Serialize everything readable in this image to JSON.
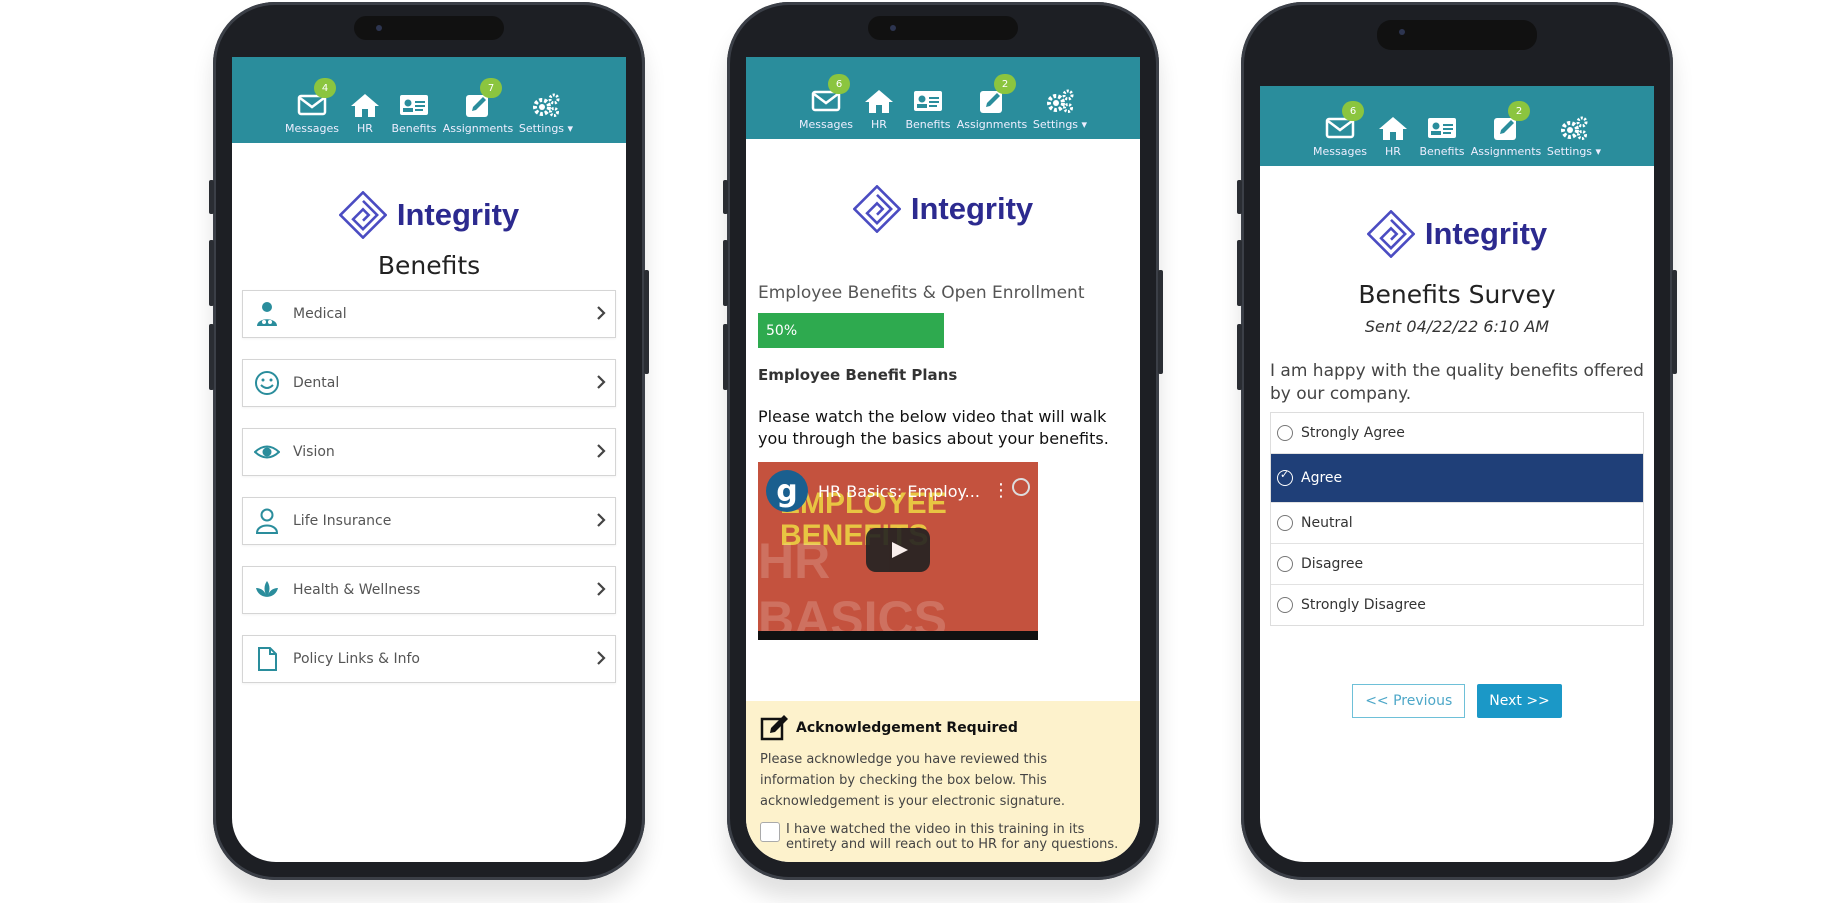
{
  "nav": {
    "items": [
      {
        "label": "Messages",
        "icon": "envelope-icon"
      },
      {
        "label": "HR",
        "icon": "home-icon"
      },
      {
        "label": "Benefits",
        "icon": "id-card-icon"
      },
      {
        "label": "Assignments",
        "icon": "edit-icon"
      },
      {
        "label": "Settings",
        "icon": "gears-icon"
      }
    ],
    "phone1_badges": {
      "messages": "4",
      "assignments": "7"
    },
    "phone2_badges": {
      "messages": "6",
      "assignments": "2"
    },
    "phone3_badges": {
      "messages": "6",
      "assignments": "2"
    }
  },
  "brand": {
    "name": "Integrity",
    "color": "#2c2a8f",
    "accent": "#2a8d9c"
  },
  "phone1": {
    "title": "Benefits",
    "items": [
      {
        "label": "Medical",
        "icon": "doctor-icon"
      },
      {
        "label": "Dental",
        "icon": "smile-icon"
      },
      {
        "label": "Vision",
        "icon": "eye-icon"
      },
      {
        "label": "Life Insurance",
        "icon": "user-icon"
      },
      {
        "label": "Health & Wellness",
        "icon": "lotus-icon"
      },
      {
        "label": "Policy Links & Info",
        "icon": "document-icon"
      }
    ]
  },
  "phone2": {
    "title": "Employee Benefits & Open Enrollment",
    "progress_label": "50%",
    "progress": 0.5,
    "subtitle": "Employee Benefit Plans",
    "description": "Please watch the below video that will walk you through the basics about your benefits.",
    "video": {
      "title": "HR Basics: Employ...",
      "overlay_text": "EMPLOYEE BENEFITS",
      "watermark": "HR BASICS"
    },
    "ack": {
      "title": "Acknowledgement Required",
      "text": "Please acknowledge you have reviewed this information by checking the box below. This acknowledgement is your electronic signature.",
      "checkbox_label": "I have watched the video in this training in its entirety and will reach out to HR for any questions."
    }
  },
  "phone3": {
    "title": "Benefits Survey",
    "sent": "Sent 04/22/22 6:10 AM",
    "question": "I am happy with the quality benefits offered by our company.",
    "options": [
      "Strongly Agree",
      "Agree",
      "Neutral",
      "Disagree",
      "Strongly Disagree"
    ],
    "selected": "Agree",
    "prev_label": "<< Previous",
    "next_label": "Next >>"
  }
}
